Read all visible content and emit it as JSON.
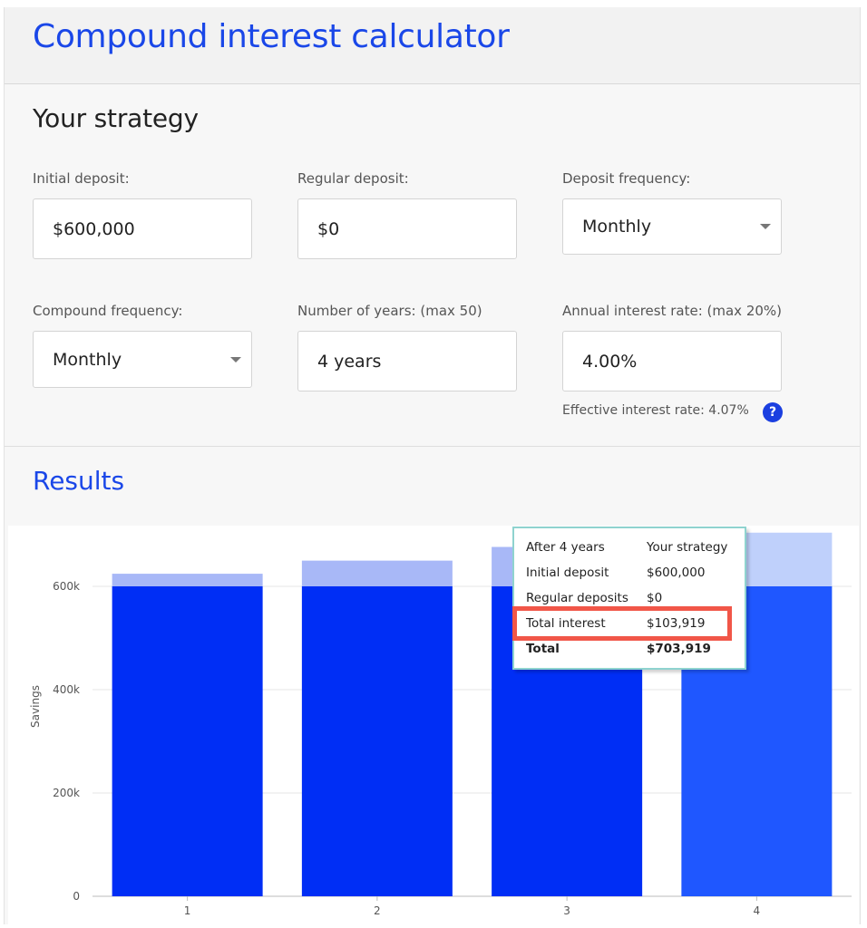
{
  "header": {
    "title": "Compound interest calculator"
  },
  "strategy": {
    "title": "Your strategy",
    "initial_deposit": {
      "label": "Initial deposit:",
      "value": "$600,000"
    },
    "regular_deposit": {
      "label": "Regular deposit:",
      "value": "$0"
    },
    "deposit_frequency": {
      "label": "Deposit frequency:",
      "value": "Monthly"
    },
    "compound_frequency": {
      "label": "Compound frequency:",
      "value": "Monthly"
    },
    "years": {
      "label": "Number of years: (max 50)",
      "value": "4 years"
    },
    "rate": {
      "label": "Annual interest rate: (max 20%)",
      "value": "4.00%"
    },
    "effective_rate": "Effective interest rate: 4.07%",
    "help_icon": "?"
  },
  "results": {
    "title": "Results"
  },
  "tooltip": {
    "heading": "After 4 years",
    "column": "Your strategy",
    "rows": [
      {
        "label": "Initial deposit",
        "value": "$600,000"
      },
      {
        "label": "Regular deposits",
        "value": "$0"
      },
      {
        "label": "Total interest",
        "value": "$103,919"
      },
      {
        "label": "Total",
        "value": "$703,919"
      }
    ]
  },
  "chart_data": {
    "type": "bar",
    "stacked": true,
    "categories": [
      "1",
      "2",
      "3",
      "4"
    ],
    "series": [
      {
        "values": [
          600000,
          600000,
          600000,
          600000
        ],
        "color": "#002ef5"
      },
      {
        "values": [
          24400,
          49800,
          76300,
          103919
        ],
        "color": "#a8b8f7"
      }
    ],
    "highlight_color": "#1f57ff",
    "highlight_light_color": "#bfd0fb",
    "ylabel": "Savings",
    "yticks": [
      "0",
      "200k",
      "400k",
      "600k"
    ],
    "ylim": [
      0,
      700000
    ],
    "grid": true
  }
}
